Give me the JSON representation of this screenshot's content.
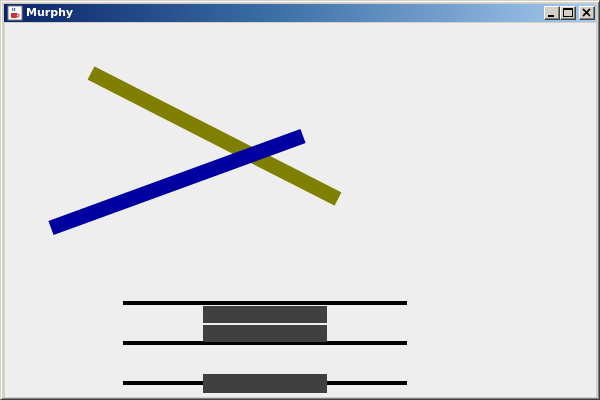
{
  "window": {
    "title": "Murphy",
    "controls": {
      "minimize_icon": "minimize-icon",
      "maximize_icon": "maximize-icon",
      "close_icon": "close-icon"
    },
    "app_icon": "java-cup-icon"
  },
  "canvas": {
    "background_color": "#eeeeee",
    "strokes": [
      {
        "name": "olive-stroke",
        "color": "#808000"
      },
      {
        "name": "blue-stroke",
        "color": "#0000a0"
      }
    ],
    "bar_color": "#404040",
    "line_color": "#000000"
  }
}
